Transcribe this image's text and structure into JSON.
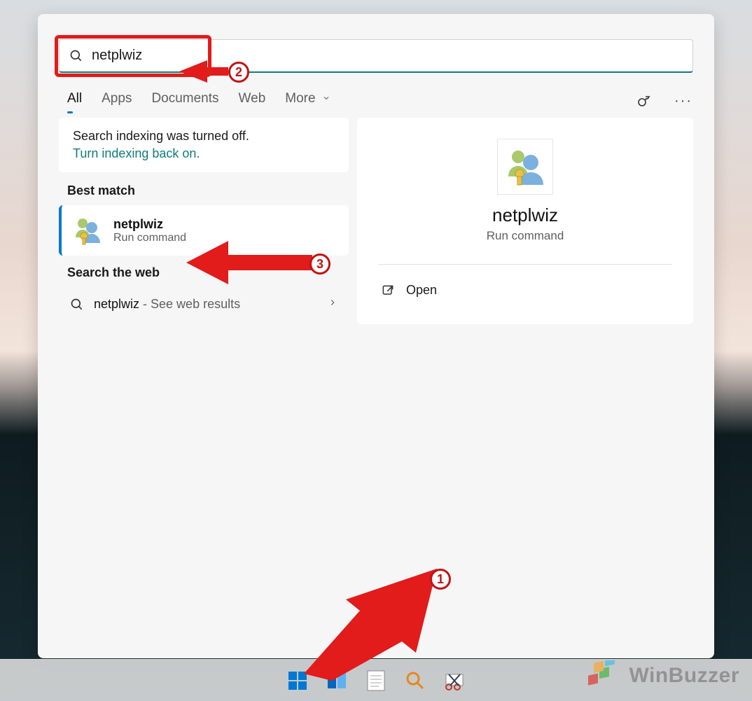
{
  "search": {
    "value": "netplwiz"
  },
  "tabs": {
    "items": [
      "All",
      "Apps",
      "Documents",
      "Web",
      "More"
    ],
    "activeIndex": 0
  },
  "notice": {
    "title": "Search indexing was turned off.",
    "link": "Turn indexing back on."
  },
  "sections": {
    "bestMatch": "Best match",
    "searchWeb": "Search the web"
  },
  "bestMatch": {
    "title": "netplwiz",
    "subtitle": "Run command"
  },
  "webResult": {
    "term": "netplwiz",
    "suffix": " - See web results"
  },
  "preview": {
    "title": "netplwiz",
    "subtitle": "Run command",
    "action": "Open"
  },
  "annotations": {
    "step1": "1",
    "step2": "2",
    "step3": "3"
  },
  "watermark": {
    "text": "WinBuzzer"
  }
}
